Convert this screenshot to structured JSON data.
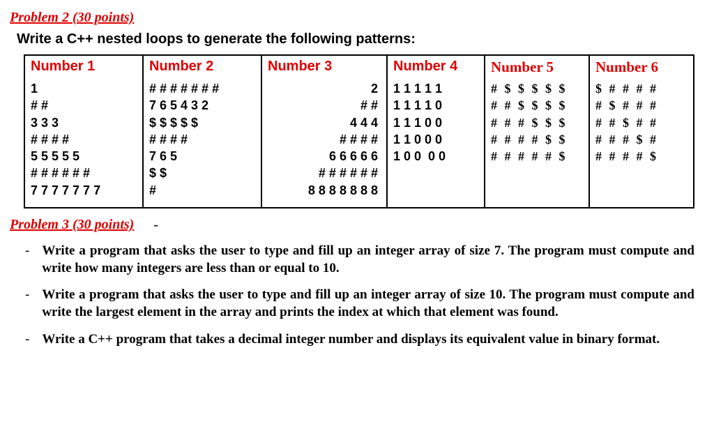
{
  "problem2": {
    "heading": "Problem 2 (30 points)",
    "instruction": "Write a C++ nested loops to generate the following patterns:",
    "headers": [
      "Number 1",
      "Number 2",
      "Number 3",
      "Number 4",
      "Number 5",
      "Number 6"
    ],
    "patterns": {
      "n1": "1\n# #\n3 3 3\n# # # #\n5 5 5 5 5\n# # # # # #\n7 7 7 7 7 7 7",
      "n2": "# # # # # # #\n7 6 5 4 3 2\n$ $ $ $ $\n# # # #\n7 6 5\n$ $\n#",
      "n3": "2\n# #\n4 4 4\n# # # #\n6 6 6 6 6\n# # # # # #\n8 8 8 8 8 8 8",
      "n4": "1 1 1 1 1\n1 1 1 1 0\n1 1 1 0 0\n1 1 0 0 0\n1 0 0  0 0",
      "n5": "# $ $ $ $ $\n# # $ $ $ $\n# # # $ $ $\n# # # # $ $\n# # # # # $",
      "n6": "$ # # # #\n# $ # # #\n# # $ # #\n# # # $ #\n# # # # $"
    }
  },
  "problem3": {
    "heading": "Problem 3 (30 points)",
    "dash": "-",
    "tasks": [
      "Write a program that asks the user to type and fill up an integer array of size 7. The program must compute and write how many integers are less than or equal to 10.",
      "Write a program that asks the user to type and fill up an integer array of size 10. The program must compute and write the largest element in the array and prints the index at which that element was found.",
      "Write a C++ program that takes a decimal integer number and displays its equivalent value in binary format."
    ]
  }
}
